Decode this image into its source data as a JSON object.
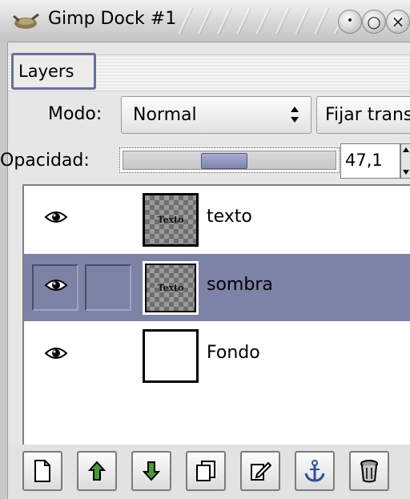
{
  "window": {
    "title": "Gimp Dock #1"
  },
  "tabs": [
    {
      "label": "Layers"
    }
  ],
  "mode": {
    "label": "Modo:",
    "value": "Normal",
    "lock_label": "Fijar trans"
  },
  "opacity": {
    "label": "Opacidad:",
    "value": "47,1"
  },
  "layers": [
    {
      "name": "texto",
      "thumb_text": "Texto",
      "visible": true,
      "selected": false
    },
    {
      "name": "sombra",
      "thumb_text": "Texto",
      "visible": true,
      "selected": true
    },
    {
      "name": "Fondo",
      "thumb_text": "",
      "visible": true,
      "selected": false
    }
  ],
  "toolbar": [
    {
      "icon": "new-layer-icon"
    },
    {
      "icon": "raise-layer-icon"
    },
    {
      "icon": "lower-layer-icon"
    },
    {
      "icon": "duplicate-layer-icon"
    },
    {
      "icon": "edit-layer-icon"
    },
    {
      "icon": "anchor-icon"
    },
    {
      "icon": "trash-icon"
    }
  ],
  "colors": {
    "selection": "#7d82a7",
    "tab_border": "#6a6f98"
  }
}
